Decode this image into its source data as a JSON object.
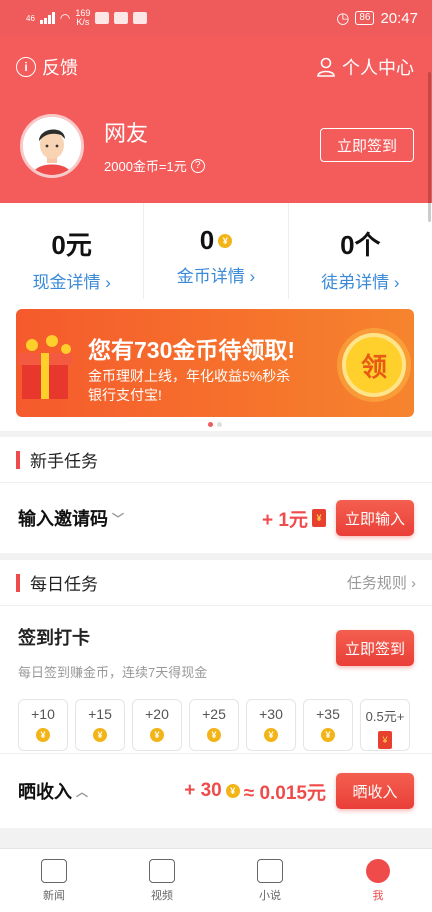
{
  "status": {
    "signal": "46",
    "netspeed_value": "169",
    "netspeed_unit": "K/s",
    "battery": "86",
    "time": "20:47"
  },
  "header": {
    "feedback_label": "反馈",
    "personal_center_label": "个人中心",
    "nickname": "网友",
    "rate_text": "2000金币=1元",
    "signin_label": "立即签到"
  },
  "stats": [
    {
      "value": "0元",
      "label": "现金详情"
    },
    {
      "value": "0",
      "label": "金币详情"
    },
    {
      "value": "0个",
      "label": "徒弟详情"
    }
  ],
  "banner": {
    "title": "您有730金币待领取!",
    "line1": "金币理财上线，年化收益5%秒杀",
    "line2": "银行支付宝!",
    "badge": "领"
  },
  "newbie": {
    "section_title": "新手任务",
    "task_title": "输入邀请码",
    "reward": "+ 1元",
    "button": "立即输入"
  },
  "daily": {
    "section_title": "每日任务",
    "rules_label": "任务规则",
    "checkin_title": "签到打卡",
    "checkin_desc": "每日签到赚金币，连续7天得现金",
    "checkin_button": "立即签到",
    "days": [
      "+10",
      "+15",
      "+20",
      "+25",
      "+30",
      "+35",
      "0.5元+"
    ]
  },
  "share": {
    "title": "晒收入",
    "reward": "+ 30",
    "approx": "≈ 0.015元",
    "button": "晒收入"
  },
  "nav": [
    "新闻",
    "视频",
    "小说",
    "我"
  ],
  "colors": {
    "brand": "#f45c5c",
    "accent": "#ef4b4b",
    "link": "#3a8ad8"
  }
}
